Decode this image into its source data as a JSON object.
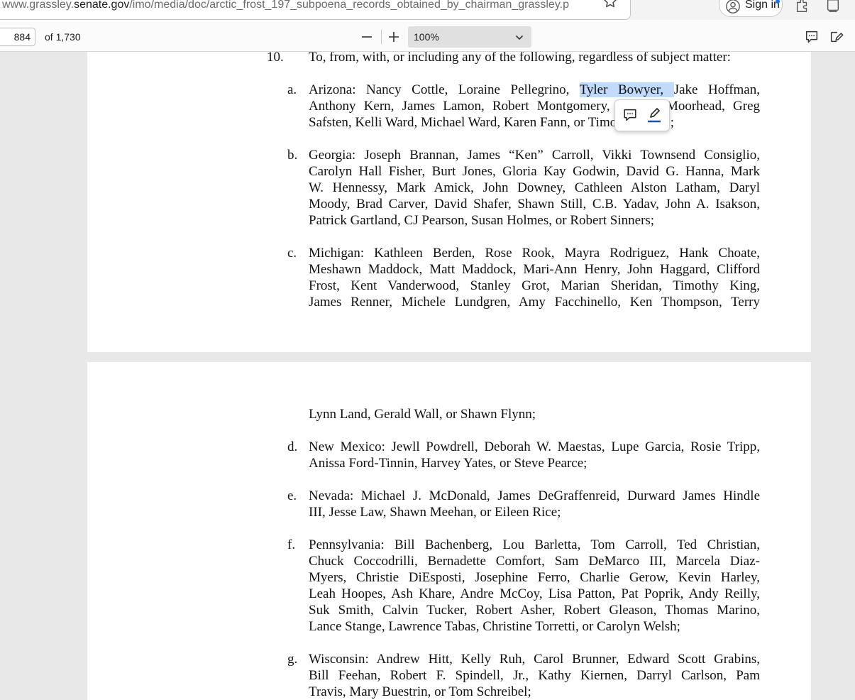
{
  "address_bar": {
    "url_domain_prefix": "www.grassley.",
    "url_domain": "senate.gov",
    "url_path": "/imo/media/doc/arctic_frost_197_subpoena_records_obtained_by_chairman_grassley.p",
    "sign_in_label": "Sign in"
  },
  "pdf_toolbar": {
    "page_number": "884",
    "page_count": "of 1,730",
    "zoom": "100%"
  },
  "document": {
    "item10_number": "10.",
    "item10_text": "To, from, with, or including any of the following, regardless of subject matter:",
    "items": [
      {
        "letter": "a.",
        "lines": [
          "Arizona: Nancy Cottle, Loraine Pellegrino, ",
          "Anthony Kern, James Lamon, Robert Montgomery, Samuel Moorhead, Greg",
          "Safsten, Kelli Ward, Michael Ward, Karen Fann, or Timothy Shane;"
        ],
        "highlight": "Tyler Bowyer, ",
        "line1_rest": "Jake Hoffman,"
      },
      {
        "letter": "b.",
        "lines": [
          "Georgia: Joseph Brannan, James “Ken” Carroll, Vikki Townsend Consiglio,",
          "Carolyn Hall Fisher, Burt Jones, Gloria Kay Godwin, David G. Hanna, Mark",
          "W. Hennessy, Mark Amick, John Downey, Cathleen Alston Latham, Daryl",
          "Moody, Brad Carver, David Shafer, Shawn Still, C.B. Yadav, John A. Isakson,",
          "Patrick Gartland, CJ Pearson, Susan Holmes, or Robert Sinners;"
        ]
      },
      {
        "letter": "c.",
        "lines": [
          "Michigan: Kathleen Berden, Rose Rook, Mayra Rodriguez, Hank Choate,",
          "Meshawn Maddock, Matt Maddock, Mari-Ann Henry, John Haggard, Clifford",
          "Frost, Kent Vanderwood, Stanley Grot, Marian Sheridan, Timothy King,",
          "James Renner, Michele Lundgren, Amy Facchinello, Ken Thompson, Terry",
          "Lynn Land, Gerald Wall, or Shawn Flynn;"
        ]
      },
      {
        "letter": "d.",
        "lines": [
          "New Mexico: Jewll Powdrell, Deborah W. Maestas, Lupe Garcia, Rosie Tripp,",
          "Anissa Ford-Tinnin, Harvey Yates, or Steve Pearce;"
        ]
      },
      {
        "letter": "e.",
        "lines": [
          "Nevada: Michael J. McDonald, James DeGraffenreid, Durward James Hindle",
          "III, Jesse Law, Shawn Meehan, or Eileen Rice;"
        ]
      },
      {
        "letter": "f.",
        "lines": [
          "Pennsylvania: Bill Bachenberg, Lou Barletta, Tom Carroll, Ted Christian,",
          "Chuck Coccodrilli, Bernadette Comfort, Sam DeMarco III, Marcela Diaz-",
          "Myers, Christie DiEsposti, Josephine Ferro, Charlie Gerow, Kevin Harley,",
          "Leah Hoopes, Ash Khare, Andre McCoy, Lisa Patton, Pat Poprik, Andy Reilly,",
          "Suk Smith, Calvin Tucker, Robert Asher, Robert Gleason, Thomas Marino,",
          "Lance Stange, Lawrence Tabas, Christine Torretti, or Carolyn Welsh;"
        ]
      },
      {
        "letter": "g.",
        "lines": [
          "Wisconsin: Andrew Hitt, Kelly Ruh, Carol Brunner, Edward Scott Grabins,",
          "Bill Feehan, Robert F. Spindell, Jr., Kathy Kiernen, Darryl Carlson, Pam",
          "Travis, Mary Buestrin, or Tom Schreibel;"
        ]
      }
    ]
  },
  "icons": {
    "favorite": "star-outline-icon",
    "avatar": "account-icon",
    "extensions": "extensions-icon",
    "collections": "collections-icon",
    "comment": "comment-icon",
    "edit": "draw-icon",
    "highlight": "highlighter-icon"
  },
  "colors": {
    "selection_highlight": "#c2dbfa",
    "toolbar_bg": "#fbfbfb",
    "viewer_bg": "#e8e8e8",
    "zoom_select_bg": "#e0e0e0"
  }
}
